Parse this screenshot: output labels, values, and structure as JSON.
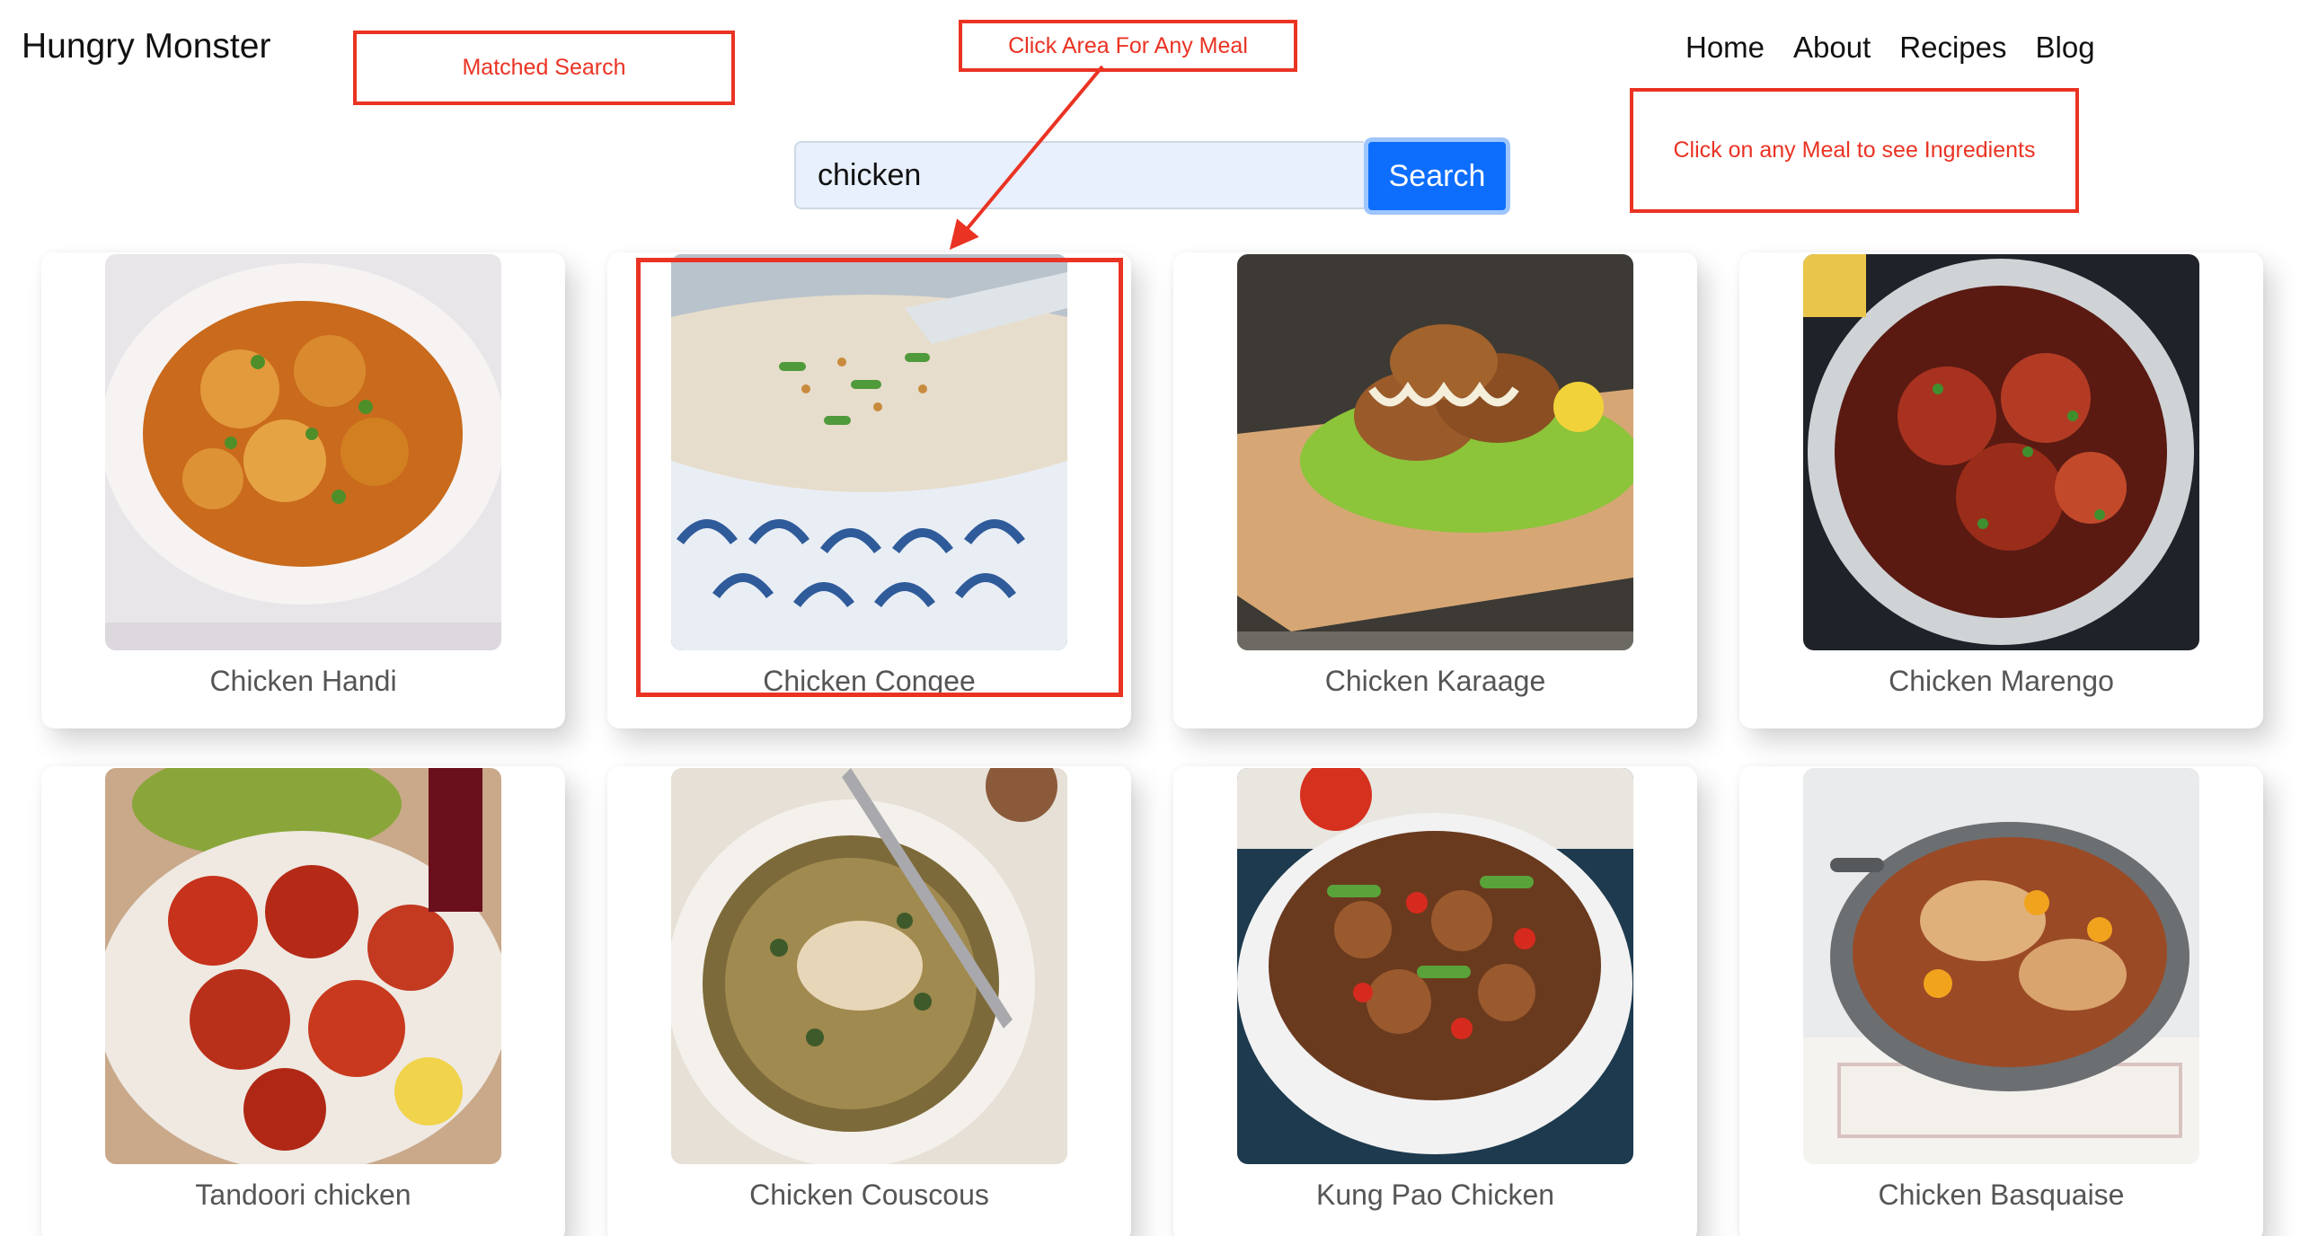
{
  "brand": "Hungry Monster",
  "nav": [
    "Home",
    "About",
    "Recipes",
    "Blog"
  ],
  "search": {
    "value": "chicken",
    "button_label": "Search"
  },
  "annotations": {
    "matched": "Matched Search",
    "click_area": "Click Area For Any Meal",
    "ingredients": "Click on any Meal to see Ingredients"
  },
  "meals": [
    {
      "name": "Chicken Handi",
      "icon": "curry-bowl-photo"
    },
    {
      "name": "Chicken Congee",
      "icon": "congee-bowl-photo"
    },
    {
      "name": "Chicken Karaage",
      "icon": "karaage-board-photo"
    },
    {
      "name": "Chicken Marengo",
      "icon": "marengo-pot-photo"
    },
    {
      "name": "Tandoori chicken",
      "icon": "tandoori-plate-photo"
    },
    {
      "name": "Chicken Couscous",
      "icon": "couscous-bowl-photo"
    },
    {
      "name": "Kung Pao Chicken",
      "icon": "kung-pao-bowl-photo"
    },
    {
      "name": "Chicken Basquaise",
      "icon": "basquaise-pan-photo"
    }
  ],
  "colors": {
    "accent": "#0d6efd",
    "annotation": "#ea3323",
    "input_bg": "#e8f0fe"
  }
}
